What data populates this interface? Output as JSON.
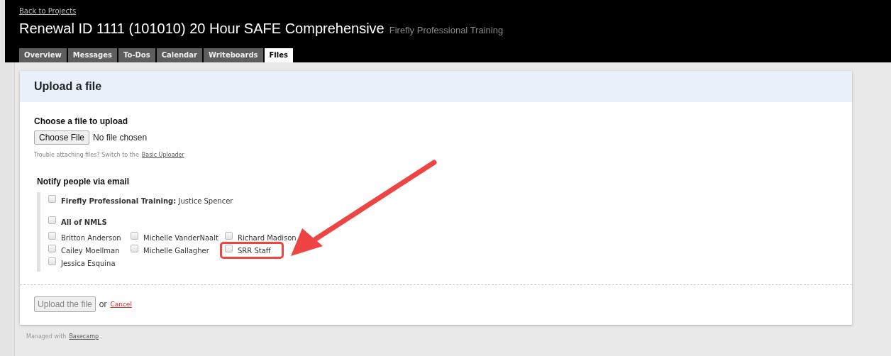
{
  "header": {
    "back_link": "Back to Projects",
    "title": "Renewal ID 1111 (101010) 20 Hour SAFE Comprehensive",
    "company": "Firefly Professional Training"
  },
  "tabs": [
    {
      "label": "Overview",
      "selected": false
    },
    {
      "label": "Messages",
      "selected": false
    },
    {
      "label": "To-Dos",
      "selected": false
    },
    {
      "label": "Calendar",
      "selected": false
    },
    {
      "label": "Writeboards",
      "selected": false
    },
    {
      "label": "Files",
      "selected": true
    }
  ],
  "panel": {
    "title": "Upload a file",
    "choose_heading": "Choose a file to upload",
    "choose_button": "Choose File",
    "file_status": "No file chosen",
    "trouble_text": "Trouble attaching files? Switch to the",
    "uploader_link": "Basic Uploader",
    "notify_heading": "Notify people via email",
    "company_entry": {
      "label": "**Firefly Professional Training:** Justice Spencer",
      "checked": false
    },
    "group": {
      "label": "All of NMLS",
      "checked": false
    },
    "people": [
      {
        "name": "Britton Anderson",
        "checked": false,
        "highlighted": false
      },
      {
        "name": "Michelle VanderNaalt",
        "checked": false,
        "highlighted": false
      },
      {
        "name": "Richard Madison",
        "checked": false,
        "highlighted": false
      },
      {
        "name": "Cailey Moellman",
        "checked": false,
        "highlighted": false
      },
      {
        "name": "Michelle Gallagher",
        "checked": false,
        "highlighted": false
      },
      {
        "name": "SRR Staff",
        "checked": false,
        "highlighted": true
      },
      {
        "name": "Jessica Esquina",
        "checked": false,
        "highlighted": false
      }
    ],
    "upload_button": "Upload the file",
    "or": "or",
    "cancel_link": "Cancel"
  },
  "footer": {
    "text": "Managed with",
    "link": "Basecamp",
    "end": "."
  }
}
